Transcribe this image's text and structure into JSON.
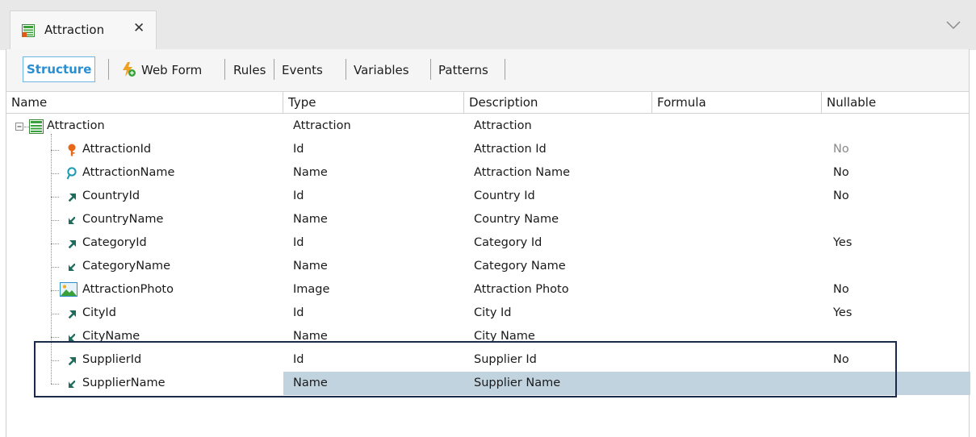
{
  "tab": {
    "title": "Attraction"
  },
  "subtabs": [
    "Structure",
    "Web Form",
    "Rules",
    "Events",
    "Variables",
    "Patterns"
  ],
  "columns": [
    "Name",
    "Type",
    "Description",
    "Formula",
    "Nullable"
  ],
  "root": {
    "name": "Attraction",
    "type": "Attraction",
    "description": "Attraction"
  },
  "rows": [
    {
      "name": "AttractionId",
      "type": "Id",
      "description": "Attraction Id",
      "nullable": "No",
      "icon": "primary-key-icon"
    },
    {
      "name": "AttractionName",
      "type": "Name",
      "description": "Attraction Name",
      "nullable": "No",
      "icon": "index-key-icon"
    },
    {
      "name": "CountryId",
      "type": "Id",
      "description": "Country Id",
      "nullable": "No",
      "icon": "foreign-key-icon"
    },
    {
      "name": "CountryName",
      "type": "Name",
      "description": "Country Name",
      "nullable": "",
      "icon": "inferred-attribute-icon"
    },
    {
      "name": "CategoryId",
      "type": "Id",
      "description": "Category Id",
      "nullable": "Yes",
      "icon": "foreign-key-icon"
    },
    {
      "name": "CategoryName",
      "type": "Name",
      "description": "Category Name",
      "nullable": "",
      "icon": "inferred-attribute-icon"
    },
    {
      "name": "AttractionPhoto",
      "type": "Image",
      "description": "Attraction Photo",
      "nullable": "No",
      "icon": "image-icon"
    },
    {
      "name": "CityId",
      "type": "Id",
      "description": "City Id",
      "nullable": "Yes",
      "icon": "foreign-key-icon"
    },
    {
      "name": "CityName",
      "type": "Name",
      "description": "City Name",
      "nullable": "",
      "icon": "inferred-attribute-icon"
    },
    {
      "name": "SupplierId",
      "type": "Id",
      "description": "Supplier Id",
      "nullable": "No",
      "icon": "foreign-key-icon"
    },
    {
      "name": "SupplierName",
      "type": "Name",
      "description": "Supplier Name",
      "nullable": "",
      "icon": "inferred-attribute-icon"
    }
  ],
  "colors": {
    "accent": "#2a8fd0",
    "selection": "#c2d3e0",
    "key_orange": "#e8681a",
    "index_teal": "#1a9bb0",
    "fk_teal": "#1f6b5c",
    "highlight_border": "#1b2a4a"
  }
}
